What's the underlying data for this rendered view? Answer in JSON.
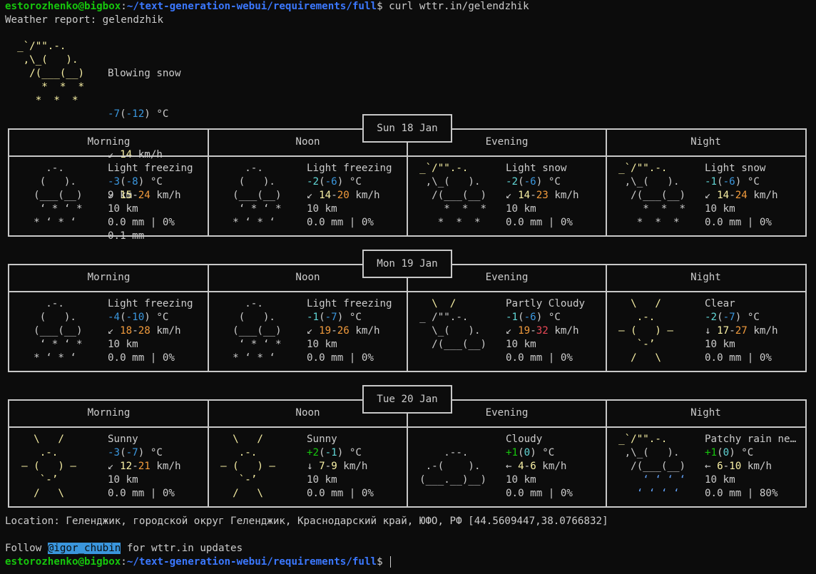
{
  "prompt": {
    "user": "estorozhenko@bigbox",
    "path": "~/text-generation-webui/requirements/full",
    "symbol": "$",
    "command": "curl wttr.in/gelendzhik"
  },
  "report_title": "Weather report: gelendzhik",
  "current": {
    "art": [
      "  _`/\"\".-.   ",
      "   ,\\_(   ).  ",
      "    /(___(__) ",
      "      *  *  * ",
      "     *  *  *  "
    ],
    "condition": "Blowing snow",
    "temp": "-7",
    "feels": "-12",
    "unit": "°C",
    "wind_arrow": "↙",
    "wind": "14",
    "wind_unit": "km/h",
    "visibility": "9 km",
    "precip": "0.1 mm"
  },
  "periods": [
    "Morning",
    "Noon",
    "Evening",
    "Night"
  ],
  "days": [
    {
      "date": "Sun 18 Jan",
      "slots": [
        {
          "icon": "freezing-drizzle-icon",
          "art": [
            "      .-.   ",
            "     (   ).  ",
            "    (___(__) ",
            "     ‘ * ‘ * ",
            "    * ‘ * ‘  "
          ],
          "condition": "Light freezing",
          "temp": "-3",
          "feels": "-8",
          "arrow": "↙",
          "wmin": "15",
          "wmax": "24",
          "vis": "10 km",
          "precip": "0.0 mm | 0%"
        },
        {
          "icon": "freezing-drizzle-icon",
          "art": [
            "      .-.   ",
            "     (   ).  ",
            "    (___(__) ",
            "     ‘ * ‘ * ",
            "    * ‘ * ‘  "
          ],
          "condition": "Light freezing",
          "temp": "-2",
          "feels": "-6",
          "arrow": "↙",
          "wmin": "14",
          "wmax": "20",
          "vis": "10 km",
          "precip": "0.0 mm | 0%"
        },
        {
          "icon": "snow-cloud-sun-icon",
          "art": [
            "  _`/\"\".-.   ",
            "   ,\\_(   ).  ",
            "    /(___(__) ",
            "      *  *  * ",
            "     *  *  *  "
          ],
          "condition": "Light snow",
          "temp": "-2",
          "feels": "-6",
          "arrow": "↙",
          "wmin": "14",
          "wmax": "23",
          "vis": "10 km",
          "precip": "0.0 mm | 0%"
        },
        {
          "icon": "snow-cloud-sun-icon",
          "art": [
            "  _`/\"\".-.   ",
            "   ,\\_(   ).  ",
            "    /(___(__) ",
            "      *  *  * ",
            "     *  *  *  "
          ],
          "condition": "Light snow",
          "temp": "-1",
          "feels": "-6",
          "arrow": "↙",
          "wmin": "14",
          "wmax": "24",
          "vis": "10 km",
          "precip": "0.0 mm | 0%"
        }
      ]
    },
    {
      "date": "Mon 19 Jan",
      "slots": [
        {
          "icon": "freezing-drizzle-icon",
          "art": [
            "      .-.   ",
            "     (   ).  ",
            "    (___(__) ",
            "     ‘ * ‘ * ",
            "    * ‘ * ‘  "
          ],
          "condition": "Light freezing",
          "temp": "-4",
          "feels": "-10",
          "arrow": "↙",
          "wmin": "18",
          "wmax": "28",
          "vis": "10 km",
          "precip": "0.0 mm | 0%"
        },
        {
          "icon": "freezing-drizzle-icon",
          "art": [
            "      .-.   ",
            "     (   ).  ",
            "    (___(__) ",
            "     ‘ * ‘ * ",
            "    * ‘ * ‘  "
          ],
          "condition": "Light freezing",
          "temp": "-1",
          "feels": "-7",
          "arrow": "↙",
          "wmin": "19",
          "wmax": "26",
          "vis": "10 km",
          "precip": "0.0 mm | 0%"
        },
        {
          "icon": "partly-cloudy-icon",
          "art": [
            "    \\  /     ",
            "  _ /\"\".-.   ",
            "    \\_(   ).  ",
            "    /(___(__) ",
            "             "
          ],
          "condition": "Partly Cloudy",
          "temp": "-1",
          "feels": "-6",
          "arrow": "↙",
          "wmin": "19",
          "wmax": "32",
          "vis": "10 km",
          "precip": "0.0 mm | 0%"
        },
        {
          "icon": "clear-night-icon",
          "art": [
            "    \\   /    ",
            "     .-.     ",
            "  ‒ (   ) ‒  ",
            "     `-’     ",
            "    /   \\    "
          ],
          "condition": "Clear",
          "temp": "-2",
          "feels": "-7",
          "arrow": "↓",
          "wmin": "17",
          "wmax": "27",
          "vis": "10 km",
          "precip": "0.0 mm | 0%"
        }
      ]
    },
    {
      "date": "Tue 20 Jan",
      "slots": [
        {
          "icon": "sun-icon",
          "art": [
            "    \\   /    ",
            "     .-.     ",
            "  ‒ (   ) ‒  ",
            "     `-’     ",
            "    /   \\    "
          ],
          "condition": "Sunny",
          "temp": "-3",
          "feels": "-7",
          "arrow": "↙",
          "wmin": "12",
          "wmax": "21",
          "vis": "10 km",
          "precip": "0.0 mm | 0%"
        },
        {
          "icon": "sun-icon",
          "art": [
            "    \\   /    ",
            "     .-.     ",
            "  ‒ (   ) ‒  ",
            "     `-’     ",
            "    /   \\    "
          ],
          "condition": "Sunny",
          "temp": "+2",
          "feels": "-1",
          "arrow": "↓",
          "wmin": "7",
          "wmax": "9",
          "vis": "10 km",
          "precip": "0.0 mm | 0%"
        },
        {
          "icon": "cloud-icon",
          "art": [
            "             ",
            "      .--.   ",
            "   .-(    ). ",
            "  (___.__)__)",
            "             "
          ],
          "condition": "Cloudy",
          "temp": "+1",
          "feels": "0",
          "arrow": "←",
          "wmin": "4",
          "wmax": "6",
          "vis": "10 km",
          "precip": "0.0 mm | 0%"
        },
        {
          "icon": "rain-cloud-sun-icon",
          "art": [
            "  _`/\"\".-.   ",
            "   ,\\_(   ).  ",
            "    /(___(__) ",
            "      ‘ ‘ ‘ ‘ ",
            "     ‘ ‘ ‘ ‘  "
          ],
          "condition": "Patchy rain ne…",
          "temp": "+1",
          "feels": "0",
          "arrow": "←",
          "wmin": "6",
          "wmax": "10",
          "vis": "10 km",
          "precip": "0.0 mm | 80%"
        }
      ]
    }
  ],
  "location": "Location: Геленджик, городской округ Геленджик, Краснодарский край, ЮФО, РФ [44.5609447,38.0766832]",
  "follow": {
    "pre": "Follow ",
    "handle": "@igor_chubin",
    "post": " for wttr.in updates"
  }
}
